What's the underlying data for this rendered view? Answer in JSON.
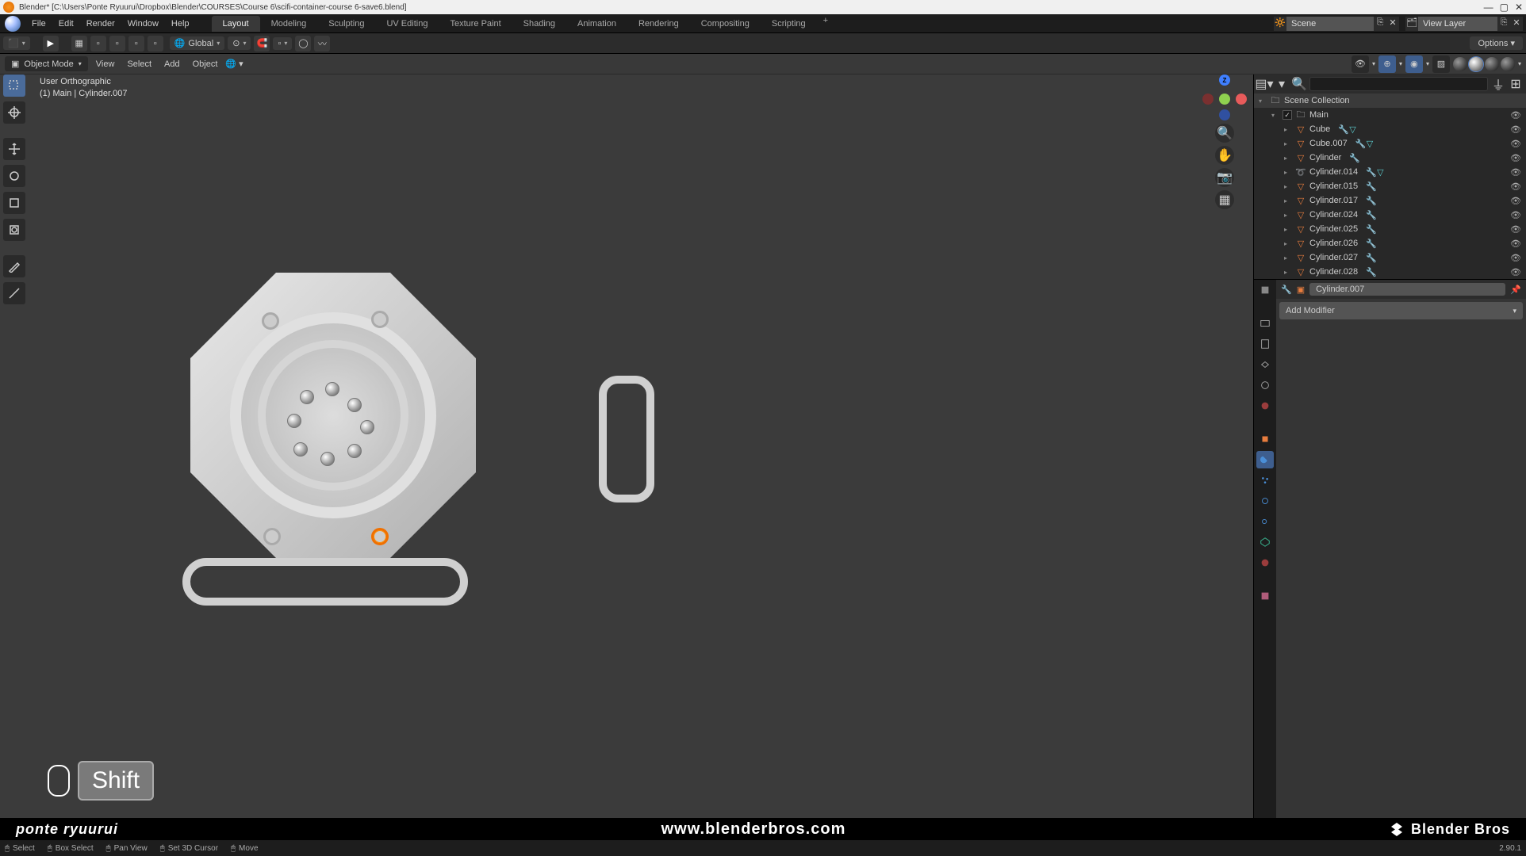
{
  "window": {
    "title": "Blender* [C:\\Users\\Ponte Ryuurui\\Dropbox\\Blender\\COURSES\\Course 6\\scifi-container-course 6-save6.blend]"
  },
  "menu": {
    "file": "File",
    "edit": "Edit",
    "render": "Render",
    "window": "Window",
    "help": "Help"
  },
  "tabs": {
    "layout": "Layout",
    "modeling": "Modeling",
    "sculpting": "Sculpting",
    "uv": "UV Editing",
    "texpaint": "Texture Paint",
    "shading": "Shading",
    "anim": "Animation",
    "rendering": "Rendering",
    "compositing": "Compositing",
    "scripting": "Scripting"
  },
  "scene": {
    "label": "Scene"
  },
  "viewlayer": {
    "label": "View Layer"
  },
  "subheader": {
    "transform": "Global",
    "options": "Options"
  },
  "modebar": {
    "mode": "Object Mode",
    "view": "View",
    "select": "Select",
    "add": "Add",
    "object": "Object"
  },
  "viewport": {
    "proj": "User Orthographic",
    "context": "(1) Main | Cylinder.007"
  },
  "keycast": {
    "key": "Shift"
  },
  "outliner": {
    "search_ph": "",
    "collection": "Scene Collection",
    "main": "Main",
    "items": [
      {
        "name": "Cube"
      },
      {
        "name": "Cube.007"
      },
      {
        "name": "Cylinder"
      },
      {
        "name": "Cylinder.014"
      },
      {
        "name": "Cylinder.015"
      },
      {
        "name": "Cylinder.017"
      },
      {
        "name": "Cylinder.024"
      },
      {
        "name": "Cylinder.025"
      },
      {
        "name": "Cylinder.026"
      },
      {
        "name": "Cylinder.027"
      },
      {
        "name": "Cylinder.028"
      }
    ]
  },
  "props": {
    "active_object": "Cylinder.007",
    "add_modifier": "Add Modifier"
  },
  "status": {
    "select": "Select",
    "box": "Box Select",
    "pan": "Pan View",
    "cursor": "Set 3D Cursor",
    "move": "Move",
    "version": "2.90.1"
  },
  "brand": {
    "left": "ponte ryuurui",
    "center": "www.blenderbros.com",
    "right": "Blender Bros"
  }
}
